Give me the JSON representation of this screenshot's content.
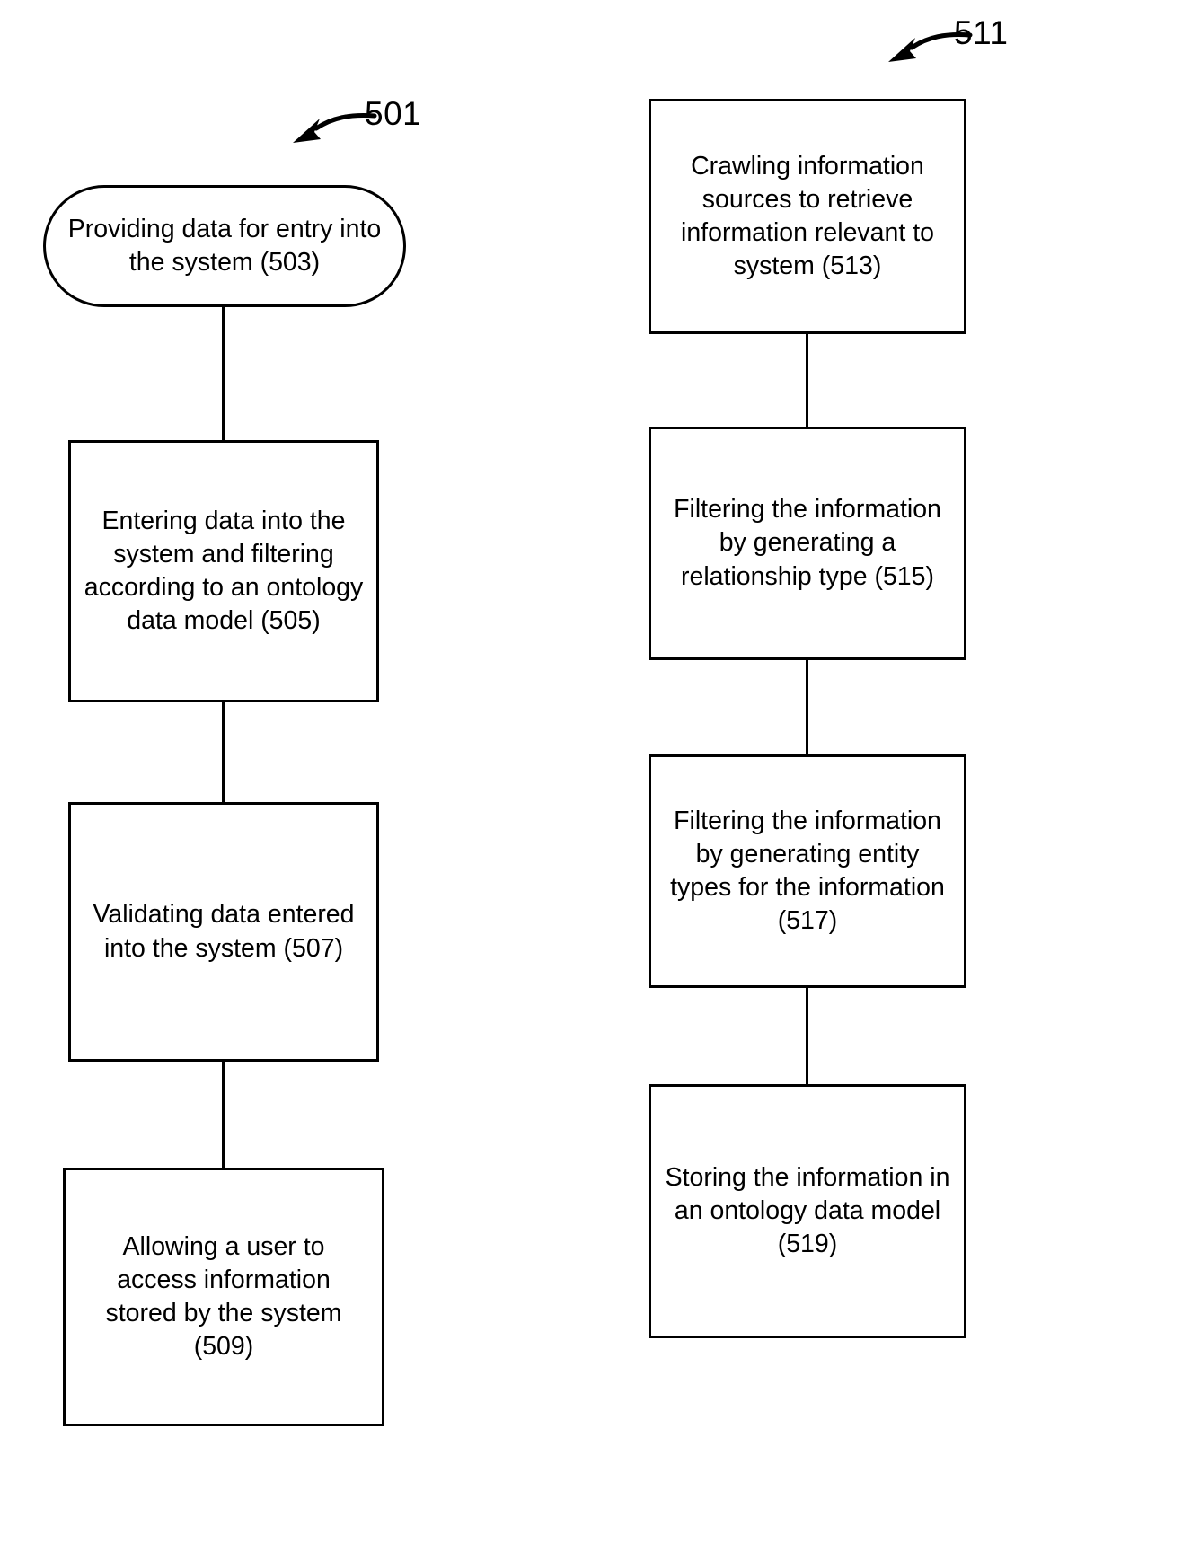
{
  "figure": {
    "background_color": "#ffffff",
    "line_color": "#000000",
    "text_color": "#000000"
  },
  "callouts": [
    {
      "id": "callout-501",
      "label": "501",
      "icon": "curved-arrow-icon"
    },
    {
      "id": "callout-511",
      "label": "511",
      "icon": "curved-arrow-icon"
    }
  ],
  "flows": [
    {
      "id": "flow-left",
      "reference": "501",
      "nodes": [
        {
          "id": "node-503",
          "ref": "503",
          "shape": "terminator",
          "text": "Providing data for entry into\nthe system (503)"
        },
        {
          "id": "node-505",
          "ref": "505",
          "shape": "process",
          "text": "Entering data into the\nsystem and filtering\naccording to an ontology\ndata model (505)"
        },
        {
          "id": "node-507",
          "ref": "507",
          "shape": "process",
          "text": "Validating data entered\ninto the system (507)"
        },
        {
          "id": "node-509",
          "ref": "509",
          "shape": "process",
          "text": "Allowing a user to\naccess information\nstored by the system\n(509)"
        }
      ]
    },
    {
      "id": "flow-right",
      "reference": "511",
      "nodes": [
        {
          "id": "node-513",
          "ref": "513",
          "shape": "process",
          "text": "Crawling information\nsources to retrieve\ninformation relevant to\nsystem (513)"
        },
        {
          "id": "node-515",
          "ref": "515",
          "shape": "process",
          "text": "Filtering the information\nby generating a\nrelationship type (515)"
        },
        {
          "id": "node-517",
          "ref": "517",
          "shape": "process",
          "text": "Filtering the information\nby generating entity\ntypes for the information\n(517)"
        },
        {
          "id": "node-519",
          "ref": "519",
          "shape": "process",
          "text": "Storing the information in\nan ontology data model\n(519)"
        }
      ]
    }
  ]
}
